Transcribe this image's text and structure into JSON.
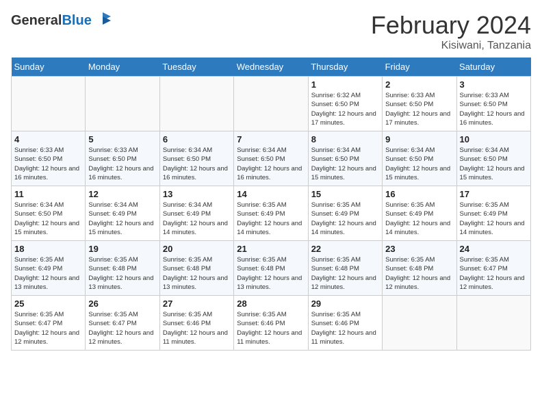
{
  "header": {
    "logo_general": "General",
    "logo_blue": "Blue",
    "month_title": "February 2024",
    "location": "Kisiwani, Tanzania"
  },
  "weekdays": [
    "Sunday",
    "Monday",
    "Tuesday",
    "Wednesday",
    "Thursday",
    "Friday",
    "Saturday"
  ],
  "weeks": [
    [
      {
        "day": "",
        "info": ""
      },
      {
        "day": "",
        "info": ""
      },
      {
        "day": "",
        "info": ""
      },
      {
        "day": "",
        "info": ""
      },
      {
        "day": "1",
        "info": "Sunrise: 6:32 AM\nSunset: 6:50 PM\nDaylight: 12 hours and 17 minutes."
      },
      {
        "day": "2",
        "info": "Sunrise: 6:33 AM\nSunset: 6:50 PM\nDaylight: 12 hours and 17 minutes."
      },
      {
        "day": "3",
        "info": "Sunrise: 6:33 AM\nSunset: 6:50 PM\nDaylight: 12 hours and 16 minutes."
      }
    ],
    [
      {
        "day": "4",
        "info": "Sunrise: 6:33 AM\nSunset: 6:50 PM\nDaylight: 12 hours and 16 minutes."
      },
      {
        "day": "5",
        "info": "Sunrise: 6:33 AM\nSunset: 6:50 PM\nDaylight: 12 hours and 16 minutes."
      },
      {
        "day": "6",
        "info": "Sunrise: 6:34 AM\nSunset: 6:50 PM\nDaylight: 12 hours and 16 minutes."
      },
      {
        "day": "7",
        "info": "Sunrise: 6:34 AM\nSunset: 6:50 PM\nDaylight: 12 hours and 16 minutes."
      },
      {
        "day": "8",
        "info": "Sunrise: 6:34 AM\nSunset: 6:50 PM\nDaylight: 12 hours and 15 minutes."
      },
      {
        "day": "9",
        "info": "Sunrise: 6:34 AM\nSunset: 6:50 PM\nDaylight: 12 hours and 15 minutes."
      },
      {
        "day": "10",
        "info": "Sunrise: 6:34 AM\nSunset: 6:50 PM\nDaylight: 12 hours and 15 minutes."
      }
    ],
    [
      {
        "day": "11",
        "info": "Sunrise: 6:34 AM\nSunset: 6:50 PM\nDaylight: 12 hours and 15 minutes."
      },
      {
        "day": "12",
        "info": "Sunrise: 6:34 AM\nSunset: 6:49 PM\nDaylight: 12 hours and 15 minutes."
      },
      {
        "day": "13",
        "info": "Sunrise: 6:34 AM\nSunset: 6:49 PM\nDaylight: 12 hours and 14 minutes."
      },
      {
        "day": "14",
        "info": "Sunrise: 6:35 AM\nSunset: 6:49 PM\nDaylight: 12 hours and 14 minutes."
      },
      {
        "day": "15",
        "info": "Sunrise: 6:35 AM\nSunset: 6:49 PM\nDaylight: 12 hours and 14 minutes."
      },
      {
        "day": "16",
        "info": "Sunrise: 6:35 AM\nSunset: 6:49 PM\nDaylight: 12 hours and 14 minutes."
      },
      {
        "day": "17",
        "info": "Sunrise: 6:35 AM\nSunset: 6:49 PM\nDaylight: 12 hours and 14 minutes."
      }
    ],
    [
      {
        "day": "18",
        "info": "Sunrise: 6:35 AM\nSunset: 6:49 PM\nDaylight: 12 hours and 13 minutes."
      },
      {
        "day": "19",
        "info": "Sunrise: 6:35 AM\nSunset: 6:48 PM\nDaylight: 12 hours and 13 minutes."
      },
      {
        "day": "20",
        "info": "Sunrise: 6:35 AM\nSunset: 6:48 PM\nDaylight: 12 hours and 13 minutes."
      },
      {
        "day": "21",
        "info": "Sunrise: 6:35 AM\nSunset: 6:48 PM\nDaylight: 12 hours and 13 minutes."
      },
      {
        "day": "22",
        "info": "Sunrise: 6:35 AM\nSunset: 6:48 PM\nDaylight: 12 hours and 12 minutes."
      },
      {
        "day": "23",
        "info": "Sunrise: 6:35 AM\nSunset: 6:48 PM\nDaylight: 12 hours and 12 minutes."
      },
      {
        "day": "24",
        "info": "Sunrise: 6:35 AM\nSunset: 6:47 PM\nDaylight: 12 hours and 12 minutes."
      }
    ],
    [
      {
        "day": "25",
        "info": "Sunrise: 6:35 AM\nSunset: 6:47 PM\nDaylight: 12 hours and 12 minutes."
      },
      {
        "day": "26",
        "info": "Sunrise: 6:35 AM\nSunset: 6:47 PM\nDaylight: 12 hours and 12 minutes."
      },
      {
        "day": "27",
        "info": "Sunrise: 6:35 AM\nSunset: 6:46 PM\nDaylight: 12 hours and 11 minutes."
      },
      {
        "day": "28",
        "info": "Sunrise: 6:35 AM\nSunset: 6:46 PM\nDaylight: 12 hours and 11 minutes."
      },
      {
        "day": "29",
        "info": "Sunrise: 6:35 AM\nSunset: 6:46 PM\nDaylight: 12 hours and 11 minutes."
      },
      {
        "day": "",
        "info": ""
      },
      {
        "day": "",
        "info": ""
      }
    ]
  ]
}
